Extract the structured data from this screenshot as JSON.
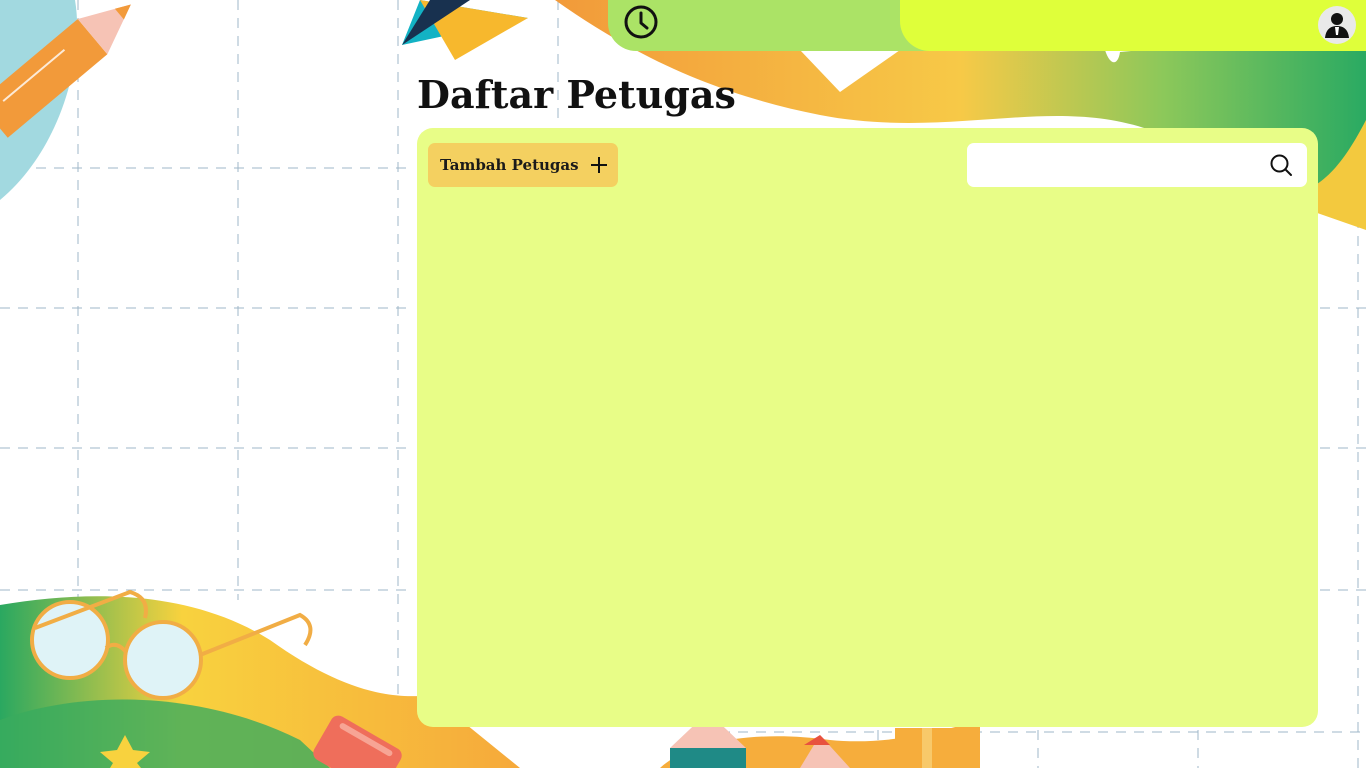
{
  "header": {
    "icons": [
      "clock-icon",
      "user-avatar-icon"
    ],
    "colors": {
      "bar_left": "#abe366",
      "bar_right": "#dfff3a"
    }
  },
  "main": {
    "title": "Daftar Petugas",
    "panel_color": "#e8fd87",
    "add_button": {
      "label": "Tambah Petugas",
      "icon": "plus-icon",
      "color": "#f4d060"
    },
    "search": {
      "value": "",
      "placeholder": "",
      "icon": "search-icon"
    }
  }
}
